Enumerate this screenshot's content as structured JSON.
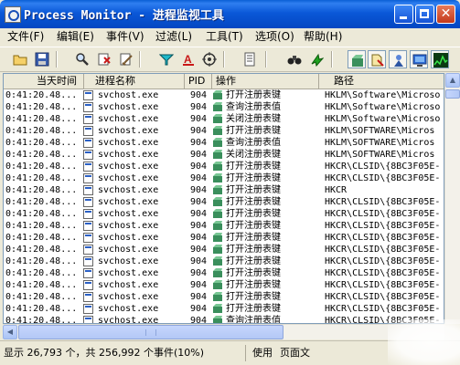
{
  "window": {
    "title": "Process Monitor - 进程监视工具"
  },
  "menu": [
    {
      "label": "文件(F)"
    },
    {
      "label": "编辑(E)"
    },
    {
      "label": "事件(V)"
    },
    {
      "label": "过滤(L)"
    },
    {
      "label": "工具(T)"
    },
    {
      "label": "选项(O)"
    },
    {
      "label": "帮助(H)"
    }
  ],
  "toolbar": {
    "buttons": [
      "open-icon",
      "save-icon",
      "find-icon",
      "autoscroll-icon",
      "clear-icon",
      "filter-icon",
      "highlight-icon",
      "target-icon",
      "jump-icon",
      "binoculars-icon",
      "jump-to-icon",
      "registry-icon",
      "file-icon",
      "network-icon",
      "process-icon",
      "profiling-icon"
    ]
  },
  "columns": [
    "当天时间",
    "进程名称",
    "PID",
    "操作",
    "路径"
  ],
  "rows": [
    {
      "time": "0:41:20.48...",
      "process": "svchost.exe",
      "pid": "904",
      "op": "打开注册表键",
      "path": "HKLM\\Software\\Microso"
    },
    {
      "time": "0:41:20.48...",
      "process": "svchost.exe",
      "pid": "904",
      "op": "查询注册表值",
      "path": "HKLM\\Software\\Microso"
    },
    {
      "time": "0:41:20.48...",
      "process": "svchost.exe",
      "pid": "904",
      "op": "关闭注册表键",
      "path": "HKLM\\Software\\Microso"
    },
    {
      "time": "0:41:20.48...",
      "process": "svchost.exe",
      "pid": "904",
      "op": "打开注册表键",
      "path": "HKLM\\SOFTWARE\\Micros"
    },
    {
      "time": "0:41:20.48...",
      "process": "svchost.exe",
      "pid": "904",
      "op": "查询注册表值",
      "path": "HKLM\\SOFTWARE\\Micros"
    },
    {
      "time": "0:41:20.48...",
      "process": "svchost.exe",
      "pid": "904",
      "op": "关闭注册表键",
      "path": "HKLM\\SOFTWARE\\Micros"
    },
    {
      "time": "0:41:20.48...",
      "process": "svchost.exe",
      "pid": "904",
      "op": "打开注册表键",
      "path": "HKCR\\CLSID\\{8BC3F05E-"
    },
    {
      "time": "0:41:20.48...",
      "process": "svchost.exe",
      "pid": "904",
      "op": "打开注册表键",
      "path": "HKCR\\CLSID\\{8BC3F05E-"
    },
    {
      "time": "0:41:20.48...",
      "process": "svchost.exe",
      "pid": "904",
      "op": "打开注册表键",
      "path": "HKCR"
    },
    {
      "time": "0:41:20.48...",
      "process": "svchost.exe",
      "pid": "904",
      "op": "打开注册表键",
      "path": "HKCR\\CLSID\\{8BC3F05E-"
    },
    {
      "time": "0:41:20.48...",
      "process": "svchost.exe",
      "pid": "904",
      "op": "打开注册表键",
      "path": "HKCR\\CLSID\\{8BC3F05E-"
    },
    {
      "time": "0:41:20.48...",
      "process": "svchost.exe",
      "pid": "904",
      "op": "打开注册表键",
      "path": "HKCR\\CLSID\\{8BC3F05E-"
    },
    {
      "time": "0:41:20.48...",
      "process": "svchost.exe",
      "pid": "904",
      "op": "打开注册表键",
      "path": "HKCR\\CLSID\\{8BC3F05E-"
    },
    {
      "time": "0:41:20.48...",
      "process": "svchost.exe",
      "pid": "904",
      "op": "打开注册表键",
      "path": "HKCR\\CLSID\\{8BC3F05E-"
    },
    {
      "time": "0:41:20.48...",
      "process": "svchost.exe",
      "pid": "904",
      "op": "打开注册表键",
      "path": "HKCR\\CLSID\\{8BC3F05E-"
    },
    {
      "time": "0:41:20.48...",
      "process": "svchost.exe",
      "pid": "904",
      "op": "打开注册表键",
      "path": "HKCR\\CLSID\\{8BC3F05E-"
    },
    {
      "time": "0:41:20.48...",
      "process": "svchost.exe",
      "pid": "904",
      "op": "打开注册表键",
      "path": "HKCR\\CLSID\\{8BC3F05E-"
    },
    {
      "time": "0:41:20.48...",
      "process": "svchost.exe",
      "pid": "904",
      "op": "打开注册表键",
      "path": "HKCR\\CLSID\\{8BC3F05E-"
    },
    {
      "time": "0:41:20.48...",
      "process": "svchost.exe",
      "pid": "904",
      "op": "打开注册表键",
      "path": "HKCR\\CLSID\\{8BC3F05E-"
    },
    {
      "time": "0:41:20.48...",
      "process": "svchost.exe",
      "pid": "904",
      "op": "查询注册表值",
      "path": "HKCR\\CLSID\\{8BC3F05E-"
    }
  ],
  "status": {
    "events": "显示 26,793 个，共 256,992 个事件(10%)",
    "mode": "使用",
    "page": "页面文"
  }
}
